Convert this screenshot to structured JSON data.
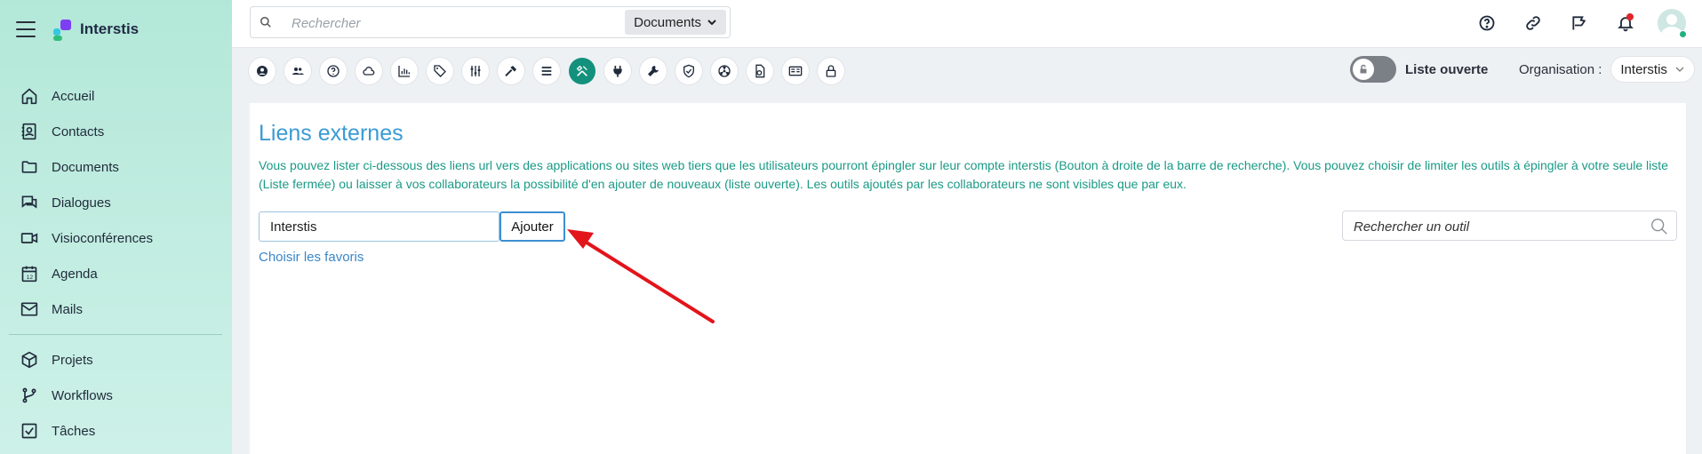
{
  "brand": {
    "name": "Interstis"
  },
  "sidebar": {
    "items": [
      {
        "label": "Accueil",
        "icon": "home-icon"
      },
      {
        "label": "Contacts",
        "icon": "contacts-icon"
      },
      {
        "label": "Documents",
        "icon": "folder-icon"
      },
      {
        "label": "Dialogues",
        "icon": "chat-icon"
      },
      {
        "label": "Visioconférences",
        "icon": "video-icon"
      },
      {
        "label": "Agenda",
        "icon": "calendar-icon"
      },
      {
        "label": "Mails",
        "icon": "mail-icon"
      }
    ],
    "items2": [
      {
        "label": "Projets",
        "icon": "cube-icon"
      },
      {
        "label": "Workflows",
        "icon": "branch-icon"
      },
      {
        "label": "Tâches",
        "icon": "checkbox-icon"
      }
    ]
  },
  "topbar": {
    "search_placeholder": "Rechercher",
    "search_scope": "Documents"
  },
  "tools": {
    "active_index": 9,
    "icons": [
      "user-icon",
      "users-icon",
      "help-icon",
      "cloud-icon",
      "chart-icon",
      "tag-icon",
      "sliders-icon",
      "hammer-icon",
      "list-icon",
      "tools-icon",
      "plug-icon",
      "wrench-icon",
      "shield-check-icon",
      "radiation-icon",
      "document-gear-icon",
      "id-card-icon",
      "lock-icon"
    ]
  },
  "toggle": {
    "label": "Liste ouverte"
  },
  "org": {
    "label": "Organisation :",
    "value": "Interstis"
  },
  "page": {
    "title": "Liens externes",
    "description": "Vous pouvez lister ci-dessous des liens url vers des applications ou sites web tiers que les utilisateurs pourront épingler sur leur compte interstis (Bouton à droite de la barre de recherche). Vous pouvez choisir de limiter les outils à épingler à votre seule liste (Liste fermée) ou laisser à vos collaborateurs la possibilité d'en ajouter de nouveaux (liste ouverte). Les outils ajoutés par les collaborateurs ne sont visibles que par eux.",
    "add_input_value": "Interstis",
    "add_button": "Ajouter",
    "favorites_link": "Choisir les favoris",
    "tool_search_placeholder": "Rechercher un outil"
  },
  "colors": {
    "accent": "#13917c",
    "title": "#3a9bd4",
    "desc": "#1a9a86",
    "arrow": "#e3141b"
  }
}
